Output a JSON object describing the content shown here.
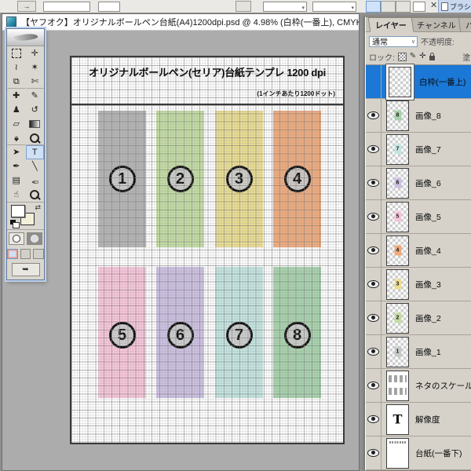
{
  "topbar": {
    "arrow_glyph": "→",
    "cancel_glyph": "✕",
    "palette_tab": "ブラシ"
  },
  "window": {
    "title": "【ヤフオク】オリジナルボールペン台紙(A4)1200dpi.psd @ 4.98% (白枠(一番上), CMYK/8)",
    "minimize_glyph": "−"
  },
  "canvas": {
    "title": "オリジナルボールペン(セリア)台紙テンプレ 1200  dpi",
    "subtitle": "(1インチあたり1200ドット)",
    "slots": [
      {
        "label": "1",
        "color": "#b4b4b4"
      },
      {
        "label": "2",
        "color": "#c3dca3"
      },
      {
        "label": "3",
        "color": "#eadd92"
      },
      {
        "label": "4",
        "color": "#eeab7e"
      },
      {
        "label": "5",
        "color": "#f7c6da"
      },
      {
        "label": "6",
        "color": "#ccc0e2"
      },
      {
        "label": "7",
        "color": "#c4e5e1"
      },
      {
        "label": "8",
        "color": "#a8d2ad"
      }
    ]
  },
  "toolbox": {
    "tools": [
      {
        "name": "rectangular-marquee-tool",
        "glyph": "",
        "kind": "marquee"
      },
      {
        "name": "move-tool",
        "glyph": "✛"
      },
      {
        "name": "lasso-tool",
        "glyph": "≀"
      },
      {
        "name": "magic-wand-tool",
        "glyph": "✶"
      },
      {
        "name": "crop-tool",
        "glyph": "⧉"
      },
      {
        "name": "slice-tool",
        "glyph": "✄"
      },
      {
        "name": "healing-brush-tool",
        "glyph": "✚"
      },
      {
        "name": "brush-tool",
        "glyph": "✎"
      },
      {
        "name": "clone-stamp-tool",
        "glyph": "♟"
      },
      {
        "name": "history-brush-tool",
        "glyph": "↺"
      },
      {
        "name": "eraser-tool",
        "glyph": "▱"
      },
      {
        "name": "gradient-tool",
        "glyph": "",
        "kind": "gradient"
      },
      {
        "name": "blur-tool",
        "glyph": "♠",
        "kind": "rot180"
      },
      {
        "name": "dodge-tool",
        "glyph": "",
        "kind": "mag"
      },
      {
        "name": "path-selection-tool",
        "glyph": "➤"
      },
      {
        "name": "type-tool",
        "glyph": "T",
        "state": "selected"
      },
      {
        "name": "pen-tool",
        "glyph": "✒"
      },
      {
        "name": "line-tool",
        "glyph": "╲"
      },
      {
        "name": "notes-tool",
        "glyph": "▤"
      },
      {
        "name": "eyedropper-tool",
        "glyph": "✑",
        "kind": "rot180"
      },
      {
        "name": "hand-tool",
        "glyph": "☝"
      },
      {
        "name": "zoom-tool",
        "glyph": "",
        "kind": "mag"
      }
    ]
  },
  "layers_panel": {
    "tabs": [
      {
        "label": "レイヤー",
        "state": "active"
      },
      {
        "label": "チャンネル"
      },
      {
        "label": "パス"
      }
    ],
    "blend_mode": "通常",
    "blend_caret": "∨",
    "opacity_label": "不透明度:",
    "lock_label": "ロック:",
    "fill_label": "塗り:",
    "rows": [
      {
        "name": "白枠(一番上)",
        "eye": false,
        "state": "selected",
        "thumb": "checker"
      },
      {
        "name": "画像_8",
        "eye": true,
        "thumb": "checker",
        "chip": "#a8d2ad",
        "num": "8"
      },
      {
        "name": "画像_7",
        "eye": true,
        "thumb": "checker",
        "chip": "#c4e5e1",
        "num": "7"
      },
      {
        "name": "画像_6",
        "eye": true,
        "thumb": "checker",
        "chip": "#ccc0e2",
        "num": "6"
      },
      {
        "name": "画像_5",
        "eye": true,
        "thumb": "checker",
        "chip": "#f7c6da",
        "num": "5"
      },
      {
        "name": "画像_4",
        "eye": true,
        "thumb": "checker",
        "chip": "#eeab7e",
        "num": "4"
      },
      {
        "name": "画像_3",
        "eye": true,
        "thumb": "checker",
        "chip": "#eadd92",
        "num": "3"
      },
      {
        "name": "画像_2",
        "eye": true,
        "thumb": "checker",
        "chip": "#c3dca3",
        "num": "2"
      },
      {
        "name": "画像_1",
        "eye": true,
        "thumb": "checker",
        "chip": "#c9c9c9",
        "num": "1"
      },
      {
        "name": "ネタのスケール",
        "eye": true,
        "thumb": "scale"
      },
      {
        "name": "解像度",
        "eye": true,
        "thumb": "text"
      },
      {
        "name": "台紙(一番下)",
        "eye": true,
        "thumb": "paper"
      }
    ]
  },
  "colors": {
    "selection_blue": "#1b78d6",
    "pasteboard_gray": "#acacac",
    "panel_gray": "#d6d2ca"
  }
}
